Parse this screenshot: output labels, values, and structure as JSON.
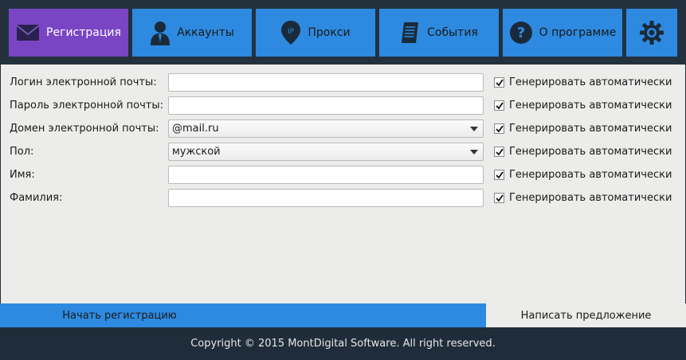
{
  "tabs": [
    {
      "id": "registration",
      "label": "Регистрация",
      "icon": "envelope-icon",
      "active": true
    },
    {
      "id": "accounts",
      "label": "Аккаунты",
      "icon": "user-icon",
      "active": false
    },
    {
      "id": "proxy",
      "label": "Прокси",
      "icon": "ip-pin-icon",
      "icon_text": "IP",
      "active": false
    },
    {
      "id": "events",
      "label": "События",
      "icon": "document-icon",
      "active": false
    },
    {
      "id": "about",
      "label": "О программе",
      "icon": "question-icon",
      "active": false
    },
    {
      "id": "settings",
      "label": "",
      "icon": "gear-icon",
      "active": false
    }
  ],
  "form": {
    "rows": [
      {
        "label": "Логин электронной почты:",
        "type": "input",
        "value": "",
        "auto_label": "Генерировать автоматически",
        "auto_checked": true
      },
      {
        "label": "Пароль электронной почты:",
        "type": "input",
        "value": "",
        "auto_label": "Генерировать автоматически",
        "auto_checked": true
      },
      {
        "label": "Домен электронной почты:",
        "type": "select",
        "value": "@mail.ru",
        "auto_label": "Генерировать автоматически",
        "auto_checked": true
      },
      {
        "label": "Пол:",
        "type": "select",
        "value": "мужской",
        "auto_label": "Генерировать автоматически",
        "auto_checked": true
      },
      {
        "label": "Имя:",
        "type": "input",
        "value": "",
        "auto_label": "Генерировать автоматически",
        "auto_checked": true
      },
      {
        "label": "Фамилия:",
        "type": "input",
        "value": "",
        "auto_label": "Генерировать автоматически",
        "auto_checked": true
      }
    ]
  },
  "actions": {
    "start_label": "Начать регистрацию",
    "suggest_label": "Написать предложение"
  },
  "footer": {
    "copyright": "Copyright © 2015 MontDigital Software. All right reserved."
  },
  "colors": {
    "accent": "#2d8ae0",
    "active_tab": "#7a45c4",
    "dark_bg": "#1f2d3a",
    "panel_bg": "#ececea"
  }
}
